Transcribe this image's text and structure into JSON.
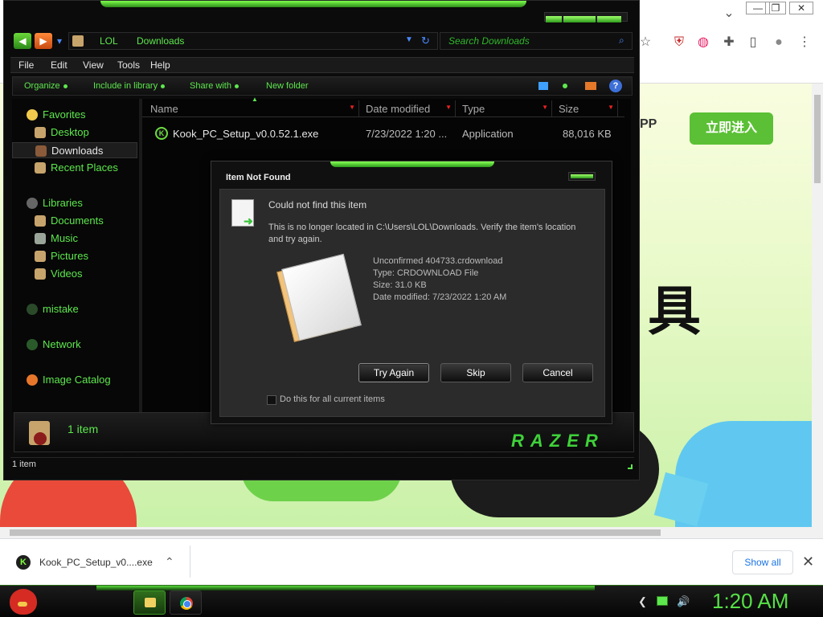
{
  "browser": {
    "caption_min": "—",
    "caption_max": "❐",
    "caption_close": "✕",
    "chevron": "⌄",
    "toolbar_icons": [
      "☆",
      "⛨",
      "◍",
      "✚",
      "▯",
      "●",
      "⋮"
    ],
    "page": {
      "app_text": "PP",
      "cta": "立即进入",
      "big_text": "具"
    }
  },
  "downloads": {
    "file_name": "Kook_PC_Setup_v0....exe",
    "file_icon": "K",
    "chevron": "⌃",
    "show_all": "Show all",
    "close": "✕"
  },
  "explorer": {
    "back": "◀",
    "forward": "▶",
    "dropdown": "▾",
    "breadcrumb": [
      "LOL",
      "Downloads"
    ],
    "addr_arrow": "▼",
    "addr_refresh": "↻",
    "search_placeholder": "Search Downloads",
    "search_icon": "⌕",
    "menu": [
      "File",
      "Edit",
      "View",
      "Tools",
      "Help"
    ],
    "commands": [
      "Organize",
      "Include in library",
      "Share with",
      "New folder"
    ],
    "help": "?",
    "nav": {
      "favorites": "Favorites",
      "desktop": "Desktop",
      "downloads": "Downloads",
      "recent": "Recent Places",
      "libraries": "Libraries",
      "documents": "Documents",
      "music": "Music",
      "pictures": "Pictures",
      "videos": "Videos",
      "mistake": "mistake",
      "network": "Network",
      "image_catalog": "Image Catalog"
    },
    "columns": [
      "Name",
      "Date modified",
      "Type",
      "Size"
    ],
    "sort_up": "▲",
    "sort_arrow": "▼",
    "files": [
      {
        "icon": "K",
        "name": "Kook_PC_Setup_v0.0.52.1.exe",
        "date": "7/23/2022 1:20 ...",
        "type": "Application",
        "size": "88,016 KB"
      }
    ],
    "details_count": "1 item",
    "brand": "RAZER",
    "status": "1 item"
  },
  "dialog": {
    "title": "Item Not Found",
    "heading": "Could not find this item",
    "message": "This is no longer located in C:\\Users\\LOL\\Downloads. Verify the item's location and try again.",
    "item_name": "Unconfirmed 404733.crdownload",
    "item_type": "Type: CRDOWNLOAD File",
    "item_size": "Size: 31.0 KB",
    "item_date": "Date modified: 7/23/2022 1:20 AM",
    "buttons": {
      "try_again": "Try Again",
      "skip": "Skip",
      "cancel": "Cancel"
    },
    "checkbox_label": "Do this for all current items"
  },
  "taskbar": {
    "tray_icons": [
      "❮",
      "🔊"
    ],
    "clock": "1:20 AM"
  }
}
